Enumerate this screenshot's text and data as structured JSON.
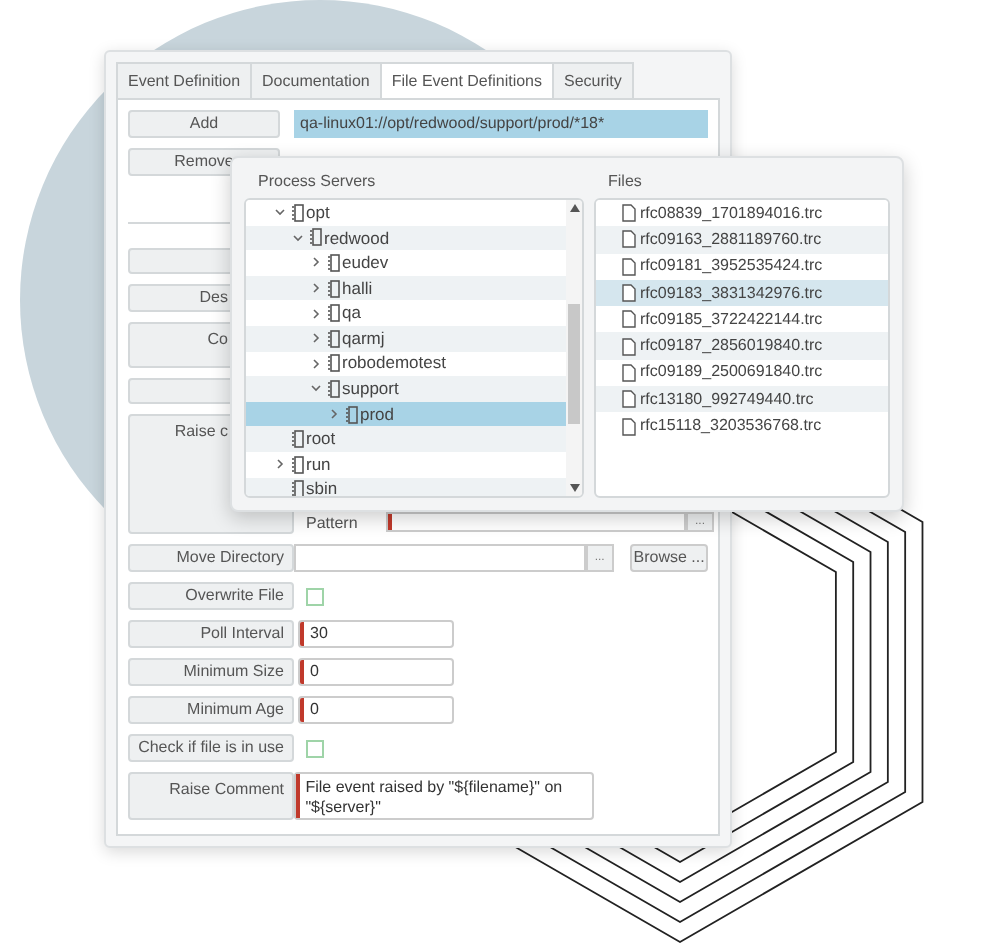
{
  "tabs": [
    {
      "label": "Event Definition",
      "selected": false
    },
    {
      "label": "Documentation",
      "selected": false
    },
    {
      "label": "File Event Definitions",
      "selected": true
    },
    {
      "label": "Security",
      "selected": false
    }
  ],
  "add_button": "Add",
  "remove_button": "Remove",
  "path_list": {
    "value": "qa-linux01://opt/redwood/support/prod/*18*"
  },
  "form_rows": [
    {
      "kind": "blank"
    },
    {
      "kind": "text",
      "label": "Des"
    },
    {
      "kind": "tall",
      "label": "Co"
    },
    {
      "kind": "blank"
    },
    {
      "kind": "group",
      "label": "Raise c",
      "sub_label": "Pattern",
      "sub_button": "...",
      "required": true
    },
    {
      "kind": "browse",
      "label": "Move Directory",
      "button": "...",
      "browse": "Browse ...",
      "required": false
    },
    {
      "kind": "checkbox",
      "label": "Overwrite File",
      "checked": false
    },
    {
      "kind": "text",
      "label": "Poll Interval",
      "value": "30",
      "required": true
    },
    {
      "kind": "text",
      "label": "Minimum Size",
      "value": "0",
      "required": true
    },
    {
      "kind": "text",
      "label": "Minimum Age",
      "value": "0",
      "required": true
    },
    {
      "kind": "checkbox",
      "label": "Check if file is in use",
      "checked": false
    },
    {
      "kind": "textarea",
      "label": "Raise Comment",
      "value": "File event raised by \"${filename}\" on \"${server}\"",
      "required": true
    }
  ],
  "popup": {
    "servers_title": "Process Servers",
    "files_title": "Files",
    "tree": [
      {
        "label": "opt",
        "expanded": true,
        "selected": false,
        "children": [
          {
            "label": "redwood",
            "expanded": true,
            "selected": false,
            "children": [
              {
                "label": "eudev",
                "expanded": false,
                "selected": false
              },
              {
                "label": "halli",
                "expanded": false,
                "selected": false
              },
              {
                "label": "qa",
                "expanded": false,
                "selected": false
              },
              {
                "label": "qarmj",
                "expanded": false,
                "selected": false
              },
              {
                "label": "robodemotest",
                "expanded": false,
                "selected": false
              },
              {
                "label": "support",
                "expanded": true,
                "selected": false,
                "children": [
                  {
                    "label": "prod",
                    "expanded": false,
                    "selected": true
                  }
                ]
              }
            ]
          }
        ]
      },
      {
        "label": "root",
        "selected": false
      },
      {
        "label": "run",
        "expanded": false,
        "selected": false
      },
      {
        "label": "sbin",
        "selected": false
      }
    ],
    "files": [
      {
        "name": "rfc08839_1701894016.trc",
        "selected": false
      },
      {
        "name": "rfc09163_2881189760.trc",
        "selected": false
      },
      {
        "name": "rfc09181_3952535424.trc",
        "selected": false
      },
      {
        "name": "rfc09183_3831342976.trc",
        "selected": true
      },
      {
        "name": "rfc09185_3722422144.trc",
        "selected": false
      },
      {
        "name": "rfc09187_2856019840.trc",
        "selected": false
      },
      {
        "name": "rfc09189_2500691840.trc",
        "selected": false
      },
      {
        "name": "rfc13180_992749440.trc",
        "selected": false
      },
      {
        "name": "rfc15118_3203536768.trc",
        "selected": false
      }
    ]
  }
}
